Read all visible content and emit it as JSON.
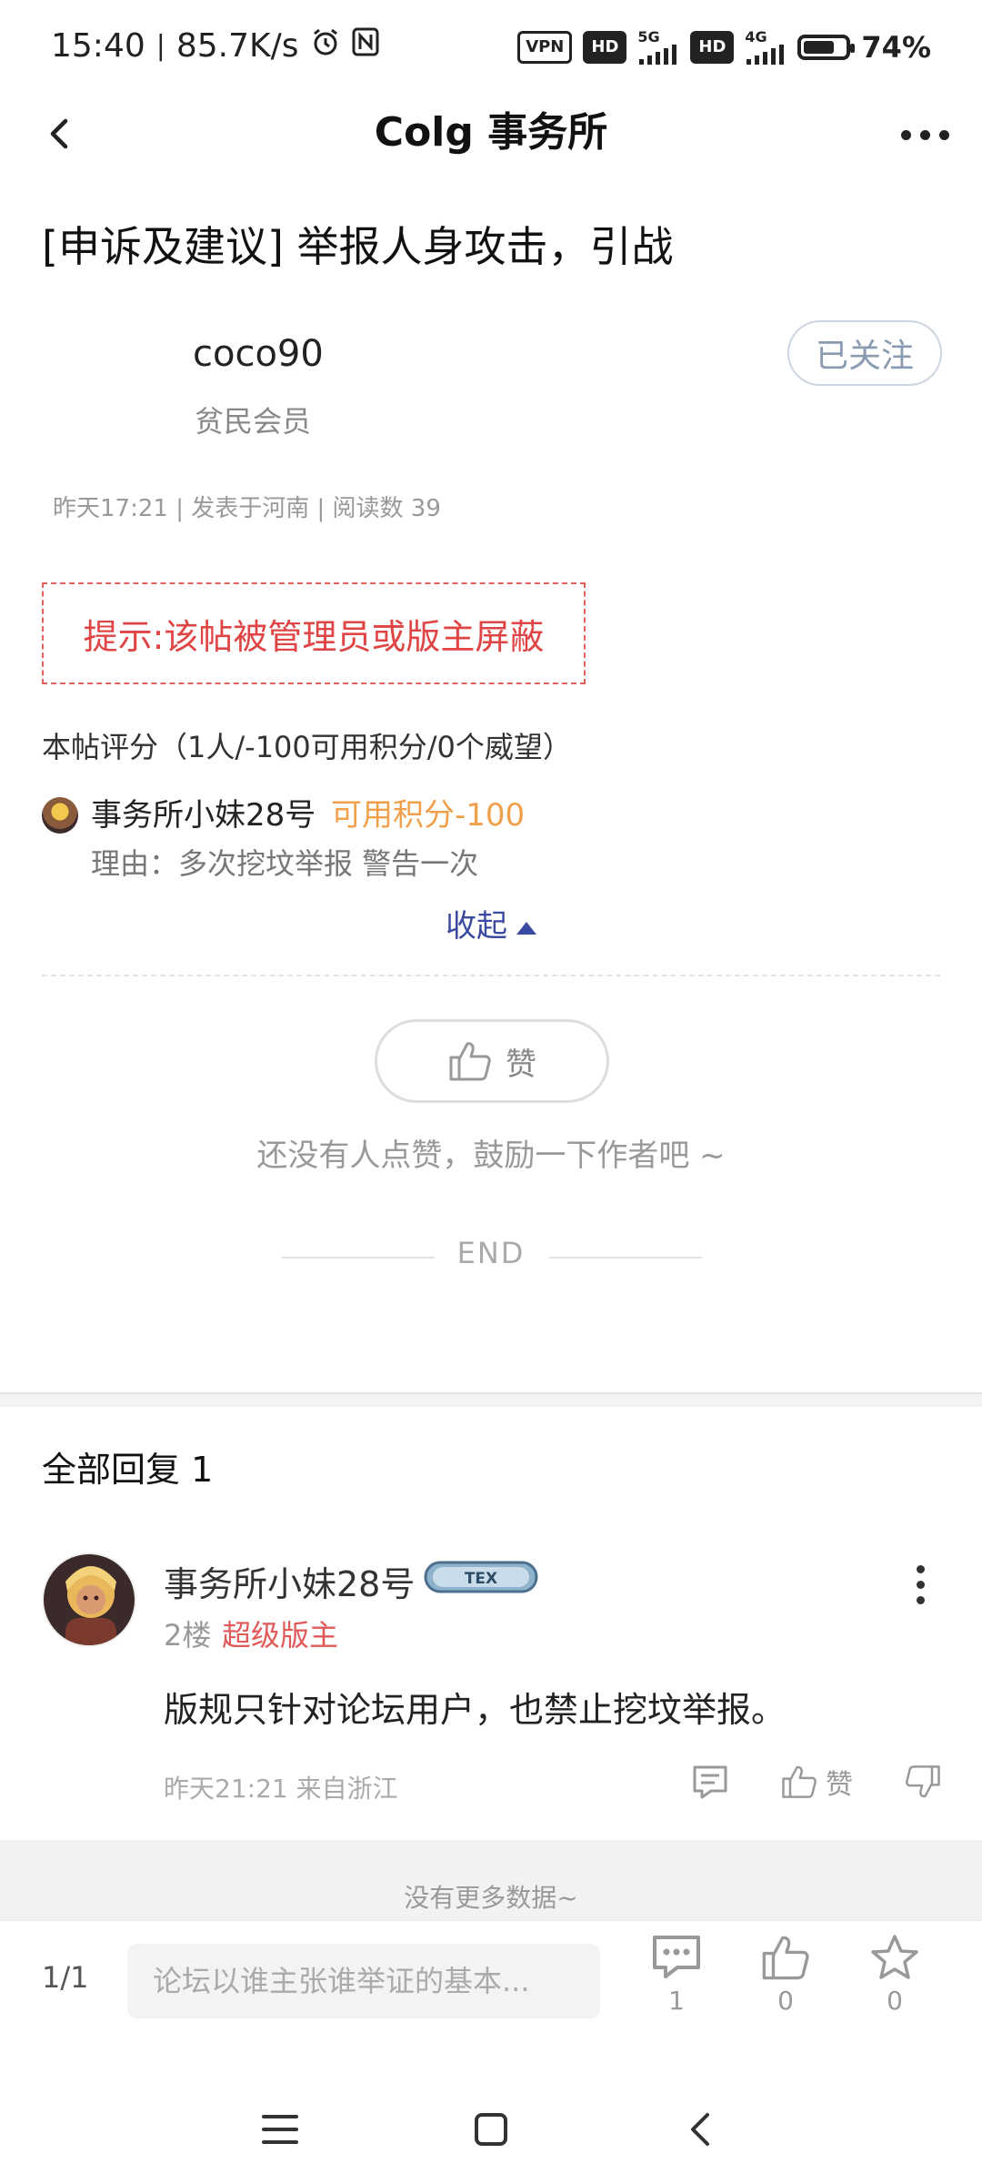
{
  "status_bar": {
    "time": "15:40",
    "speed": "85.7K/s",
    "vpn": "VPN",
    "hd1": "HD",
    "net1": "5G",
    "hd2": "HD",
    "net2": "4G",
    "battery_text": "74%",
    "battery_level": 0.74
  },
  "header": {
    "title": "Colg 事务所"
  },
  "post": {
    "title": "[申诉及建议] 举报人身攻击，引战",
    "author_name": "coco90",
    "author_rank": "贫民会员",
    "follow_label": "已关注",
    "meta": "昨天17:21 | 发表于河南 | 阅读数 39",
    "notice": "提示:该帖被管理员或版主屏蔽"
  },
  "rating": {
    "summary": "本帖评分（1人/-100可用积分/0个威望）",
    "rater_name": "事务所小妹28号",
    "score": "可用积分-100",
    "reason": "理由：多次挖坟举报 警告一次",
    "collapse_label": "收起"
  },
  "like": {
    "label": "赞",
    "encourage": "还没有人点赞，鼓励一下作者吧 ~",
    "end": "END"
  },
  "replies": {
    "title": "全部回复  1",
    "items": [
      {
        "name": "事务所小妹28号",
        "badge": "TEX",
        "floor": "2楼",
        "role": "超级版主",
        "body": "版规只针对论坛用户，也禁止挖坟举报。",
        "time": "昨天21:21 来自浙江",
        "like_label": "赞"
      }
    ],
    "no_more": "没有更多数据~"
  },
  "bottom_bar": {
    "page": "1/1",
    "input_placeholder": "论坛以谁主张谁举证的基本...",
    "comment_count": "1",
    "like_count": "0",
    "fav_count": "0"
  },
  "colors": {
    "notice_red": "#e04545",
    "score_orange": "#f0a04b",
    "role_red": "#e05a5a",
    "collapse_blue": "#3a4aa0"
  }
}
